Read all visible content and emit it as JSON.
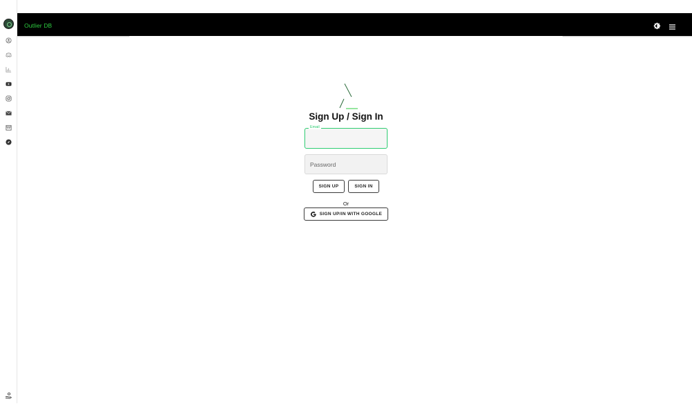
{
  "app": {
    "brand": "Outlier DB"
  },
  "sidebar": {
    "items": [
      {
        "icon": "user-circle-icon"
      },
      {
        "icon": "discord-icon"
      },
      {
        "icon": "chart-icon"
      },
      {
        "icon": "youtube-icon"
      },
      {
        "icon": "instagram-icon"
      },
      {
        "icon": "mail-icon"
      },
      {
        "icon": "calendar-icon"
      },
      {
        "icon": "compass-icon"
      }
    ],
    "bottom_icon": "hand-coin-icon"
  },
  "header": {
    "theme_icon": "theme-toggle-icon",
    "menu_icon": "hamburger-menu-icon"
  },
  "auth": {
    "title": "Sign Up / Sign In",
    "email_label": "Email",
    "email_value": "",
    "password_placeholder": "Password",
    "signup_label": "SIGN UP",
    "signin_label": "SIGN IN",
    "or_text": "Or",
    "google_label": "SIGN UP/IN WITH GOOGLE"
  },
  "colors": {
    "accent": "#2ecc40",
    "topbar": "#000000",
    "field_focus": "#2ecc71"
  }
}
